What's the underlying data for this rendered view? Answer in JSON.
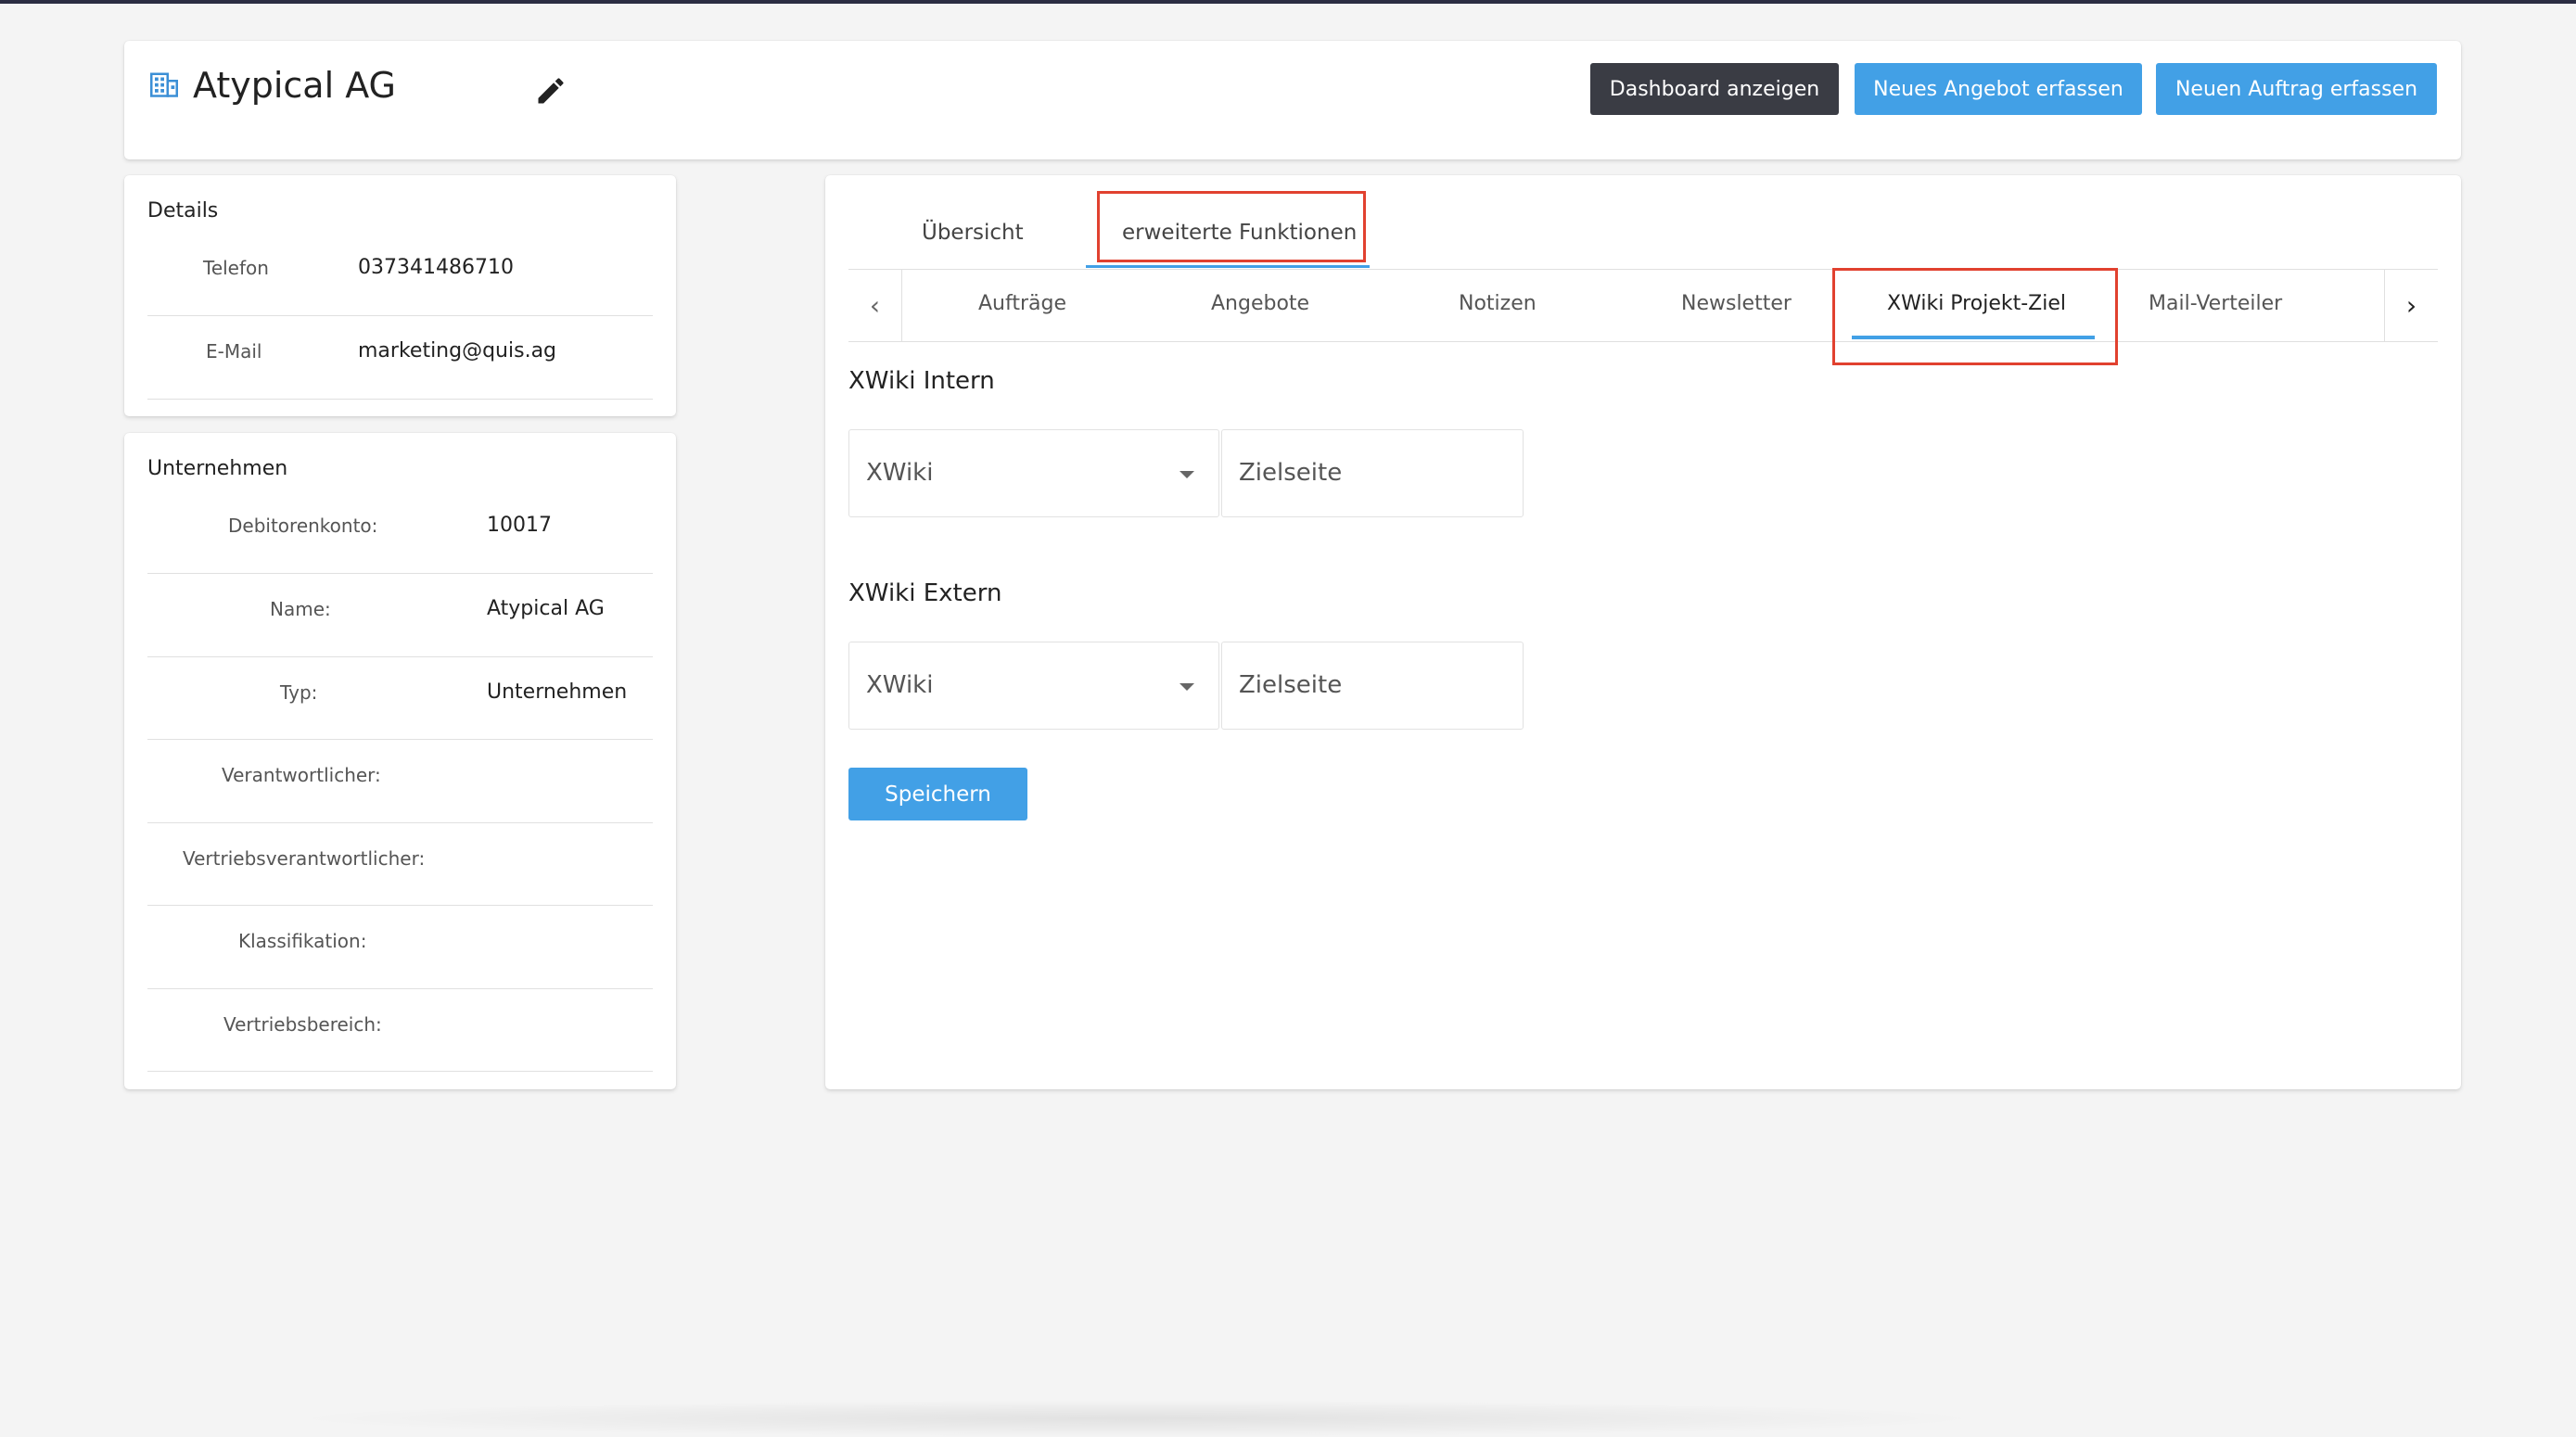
{
  "header": {
    "company_icon": "building-icon",
    "title": "Atypical AG",
    "edit_icon": "pencil-icon",
    "buttons": {
      "dashboard": "Dashboard anzeigen",
      "new_offer": "Neues Angebot erfassen",
      "new_order": "Neuen Auftrag erfassen"
    }
  },
  "details": {
    "title": "Details",
    "rows": [
      {
        "label": "Telefon",
        "value": "037341486710"
      },
      {
        "label": "E-Mail",
        "value": "marketing@quis.ag"
      }
    ]
  },
  "company": {
    "title": "Unternehmen",
    "rows": [
      {
        "label": "Debitorenkonto:",
        "value": "10017"
      },
      {
        "label": "Name:",
        "value": "Atypical AG"
      },
      {
        "label": "Typ:",
        "value": "Unternehmen"
      },
      {
        "label": "Verantwortlicher:",
        "value": ""
      },
      {
        "label": "Vertriebsverantwortlicher:",
        "value": ""
      },
      {
        "label": "Klassifikation:",
        "value": ""
      },
      {
        "label": "Vertriebsbereich:",
        "value": ""
      }
    ]
  },
  "main": {
    "top_tabs": [
      "Übersicht",
      "erweiterte Funktionen"
    ],
    "active_top_tab": "erweiterte Funktionen",
    "sub_tabs": [
      "Aufträge",
      "Angebote",
      "Notizen",
      "Newsletter",
      "XWiki Projekt-Ziel",
      "Mail-Verteiler"
    ],
    "active_sub_tab": "XWiki Projekt-Ziel",
    "sections": [
      {
        "title": "XWiki Intern",
        "select_value": "XWiki",
        "input_placeholder": "Zielseite"
      },
      {
        "title": "XWiki Extern",
        "select_value": "XWiki",
        "input_placeholder": "Zielseite"
      }
    ],
    "save_label": "Speichern"
  },
  "colors": {
    "accent": "#42a0e6",
    "dark_button": "#3a3c44",
    "highlight_box": "#e1412f"
  }
}
